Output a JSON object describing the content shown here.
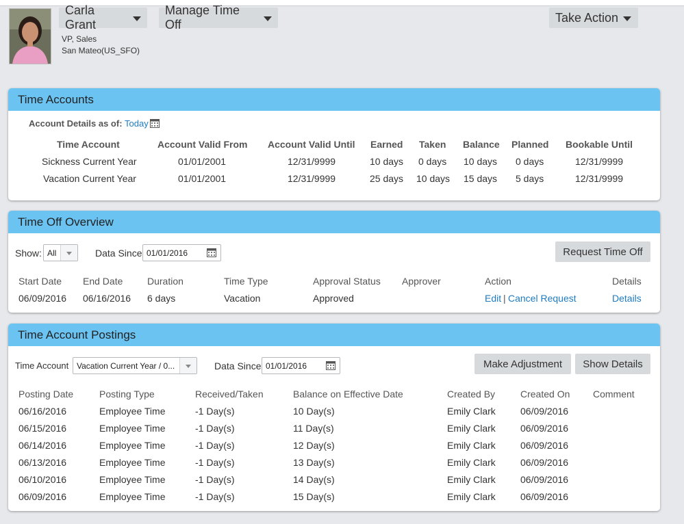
{
  "employee": {
    "name": "Carla Grant",
    "title": "VP, Sales",
    "location": "San Mateo(US_SFO)"
  },
  "header": {
    "manage_label": "Manage Time Off",
    "take_action_label": "Take Action"
  },
  "time_accounts": {
    "title": "Time Accounts",
    "as_of_label": "Account Details as of:",
    "as_of_value": "Today",
    "columns": [
      "Time Account",
      "Account Valid From",
      "Account Valid Until",
      "Earned",
      "Taken",
      "Balance",
      "Planned",
      "Bookable Until"
    ],
    "rows": [
      [
        "Sickness Current Year",
        "01/01/2001",
        "12/31/9999",
        "10 days",
        "0 days",
        "10 days",
        "0 days",
        "12/31/9999"
      ],
      [
        "Vacation Current Year",
        "01/01/2001",
        "12/31/9999",
        "25 days",
        "10 days",
        "15 days",
        "5 days",
        "12/31/9999"
      ]
    ]
  },
  "overview": {
    "title": "Time Off Overview",
    "show_label": "Show:",
    "show_value": "All",
    "data_since_label": "Data Since",
    "data_since_value": "01/01/2016",
    "request_button": "Request Time Off",
    "columns": [
      "Start Date",
      "End Date",
      "Duration",
      "Time Type",
      "Approval Status",
      "Approver",
      "Action",
      "Details"
    ],
    "rows": [
      {
        "start": "06/09/2016",
        "end": "06/16/2016",
        "duration": "6 days",
        "type": "Vacation",
        "status": "Approved",
        "approver": "",
        "action_edit": "Edit",
        "action_sep": "|",
        "action_cancel": "Cancel Request",
        "details": "Details"
      }
    ]
  },
  "postings": {
    "title": "Time Account Postings",
    "account_label": "Time Account",
    "account_value": "Vacation Current Year / 0...",
    "data_since_label": "Data Since",
    "data_since_value": "01/01/2016",
    "adjust_button": "Make Adjustment",
    "show_details_button": "Show Details",
    "columns": [
      "Posting Date",
      "Posting Type",
      "Received/Taken",
      "Balance on Effective Date",
      "Created By",
      "Created On",
      "Comment"
    ],
    "rows": [
      [
        "06/16/2016",
        "Employee Time",
        "-1 Day(s)",
        "10 Day(s)",
        "Emily Clark",
        "06/09/2016",
        ""
      ],
      [
        "06/15/2016",
        "Employee Time",
        "-1 Day(s)",
        "11 Day(s)",
        "Emily Clark",
        "06/09/2016",
        ""
      ],
      [
        "06/14/2016",
        "Employee Time",
        "-1 Day(s)",
        "12 Day(s)",
        "Emily Clark",
        "06/09/2016",
        ""
      ],
      [
        "06/13/2016",
        "Employee Time",
        "-1 Day(s)",
        "13 Day(s)",
        "Emily Clark",
        "06/09/2016",
        ""
      ],
      [
        "06/10/2016",
        "Employee Time",
        "-1 Day(s)",
        "14 Day(s)",
        "Emily Clark",
        "06/09/2016",
        ""
      ],
      [
        "06/09/2016",
        "Employee Time",
        "-1 Day(s)",
        "15 Day(s)",
        "Emily Clark",
        "06/09/2016",
        ""
      ]
    ]
  },
  "colors": {
    "panel_header": "#6bc3f2",
    "link": "#1f7bc1",
    "button": "#d7dadd",
    "background": "#e6e8eb"
  },
  "icons": [
    "calendar-icon",
    "caret-down-icon",
    "avatar-photo"
  ]
}
